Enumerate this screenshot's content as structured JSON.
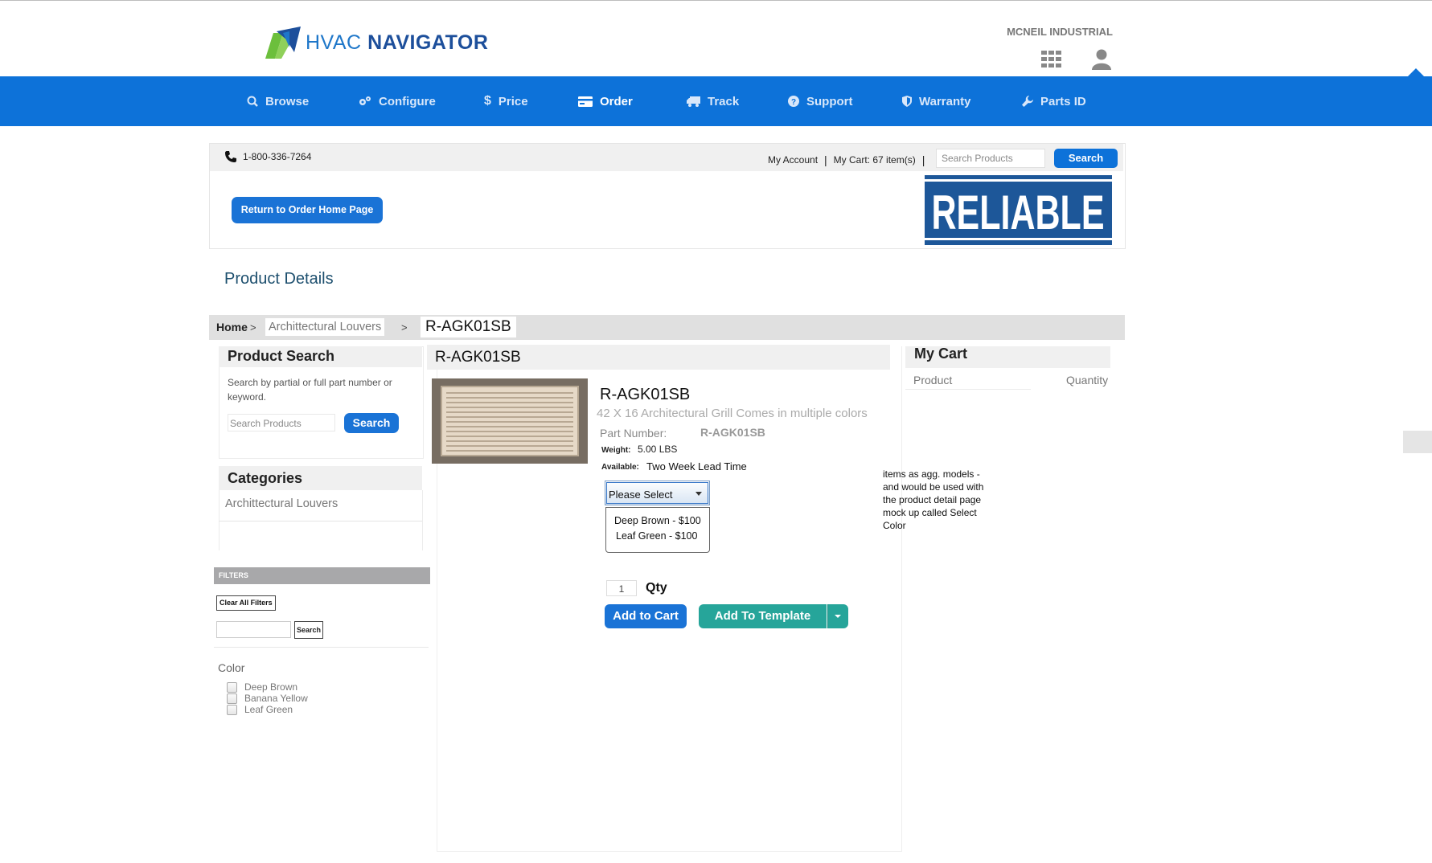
{
  "header": {
    "logo_hvac": "HVAC",
    "logo_navigator": "NAVIGATOR",
    "company": "MCNEIL INDUSTRIAL"
  },
  "nav": {
    "items": [
      {
        "label": "Browse",
        "icon": "search-icon"
      },
      {
        "label": "Configure",
        "icon": "gears-icon"
      },
      {
        "label": "Price",
        "icon": "dollar-icon"
      },
      {
        "label": "Order",
        "icon": "credit-card-icon",
        "active": true
      },
      {
        "label": "Track",
        "icon": "truck-icon"
      },
      {
        "label": "Support",
        "icon": "question-icon"
      },
      {
        "label": "Warranty",
        "icon": "shield-icon"
      },
      {
        "label": "Parts ID",
        "icon": "wrench-icon"
      }
    ]
  },
  "store": {
    "phone": "1-800-336-7264",
    "my_account": "My Account",
    "my_cart": "My Cart: 67 item(s)",
    "separator": "|",
    "search_placeholder": "Search Products",
    "search_button": "Search",
    "return_button": "Return to Order Home Page",
    "brand_logo": "RELIABLE"
  },
  "page": {
    "heading": "Product Details"
  },
  "breadcrumb": {
    "home": "Home",
    "sep": ">",
    "category": "Archittectural Louvers",
    "current": "R-AGK01SB"
  },
  "product_search": {
    "title": "Product Search",
    "description": "Search by partial or full part number or keyword.",
    "placeholder": "Search Products",
    "button": "Search"
  },
  "categories": {
    "title": "Categories",
    "items": [
      "Archittectural Louvers"
    ]
  },
  "filters": {
    "title": "FILTERS",
    "clear_button": "Clear All Filters",
    "search_button": "Search",
    "color_label": "Color",
    "colors": [
      "Deep Brown",
      "Banana Yellow",
      "Leaf Green"
    ]
  },
  "product": {
    "header_title": "R-AGK01SB",
    "name": "R-AGK01SB",
    "description": "42 X 16 Architectural Grill Comes in multiple colors",
    "part_number_label": "Part Number:",
    "part_number": "R-AGK01SB",
    "weight_label": "Weight:",
    "weight": "5.00 LBS",
    "available_label": "Available:",
    "available": "Two Week Lead Time",
    "select_value": "Please Select",
    "options": [
      "Deep Brown - $100",
      "Leaf Green - $100"
    ],
    "qty_value": "1",
    "qty_label": "Qty",
    "add_to_cart": "Add to Cart",
    "add_to_template": "Add To Template",
    "note": "items as agg. models - and would be used with the product detail page mock up called Select Color"
  },
  "cart": {
    "title": "My Cart",
    "col_product": "Product",
    "col_quantity": "Quantity"
  },
  "colors": {
    "nav_blue": "#0d72d9",
    "button_blue": "#1a73d6",
    "teal": "#26a59a",
    "logo_green": "#6cbf3c",
    "reliable_blue": "#1d5799"
  }
}
